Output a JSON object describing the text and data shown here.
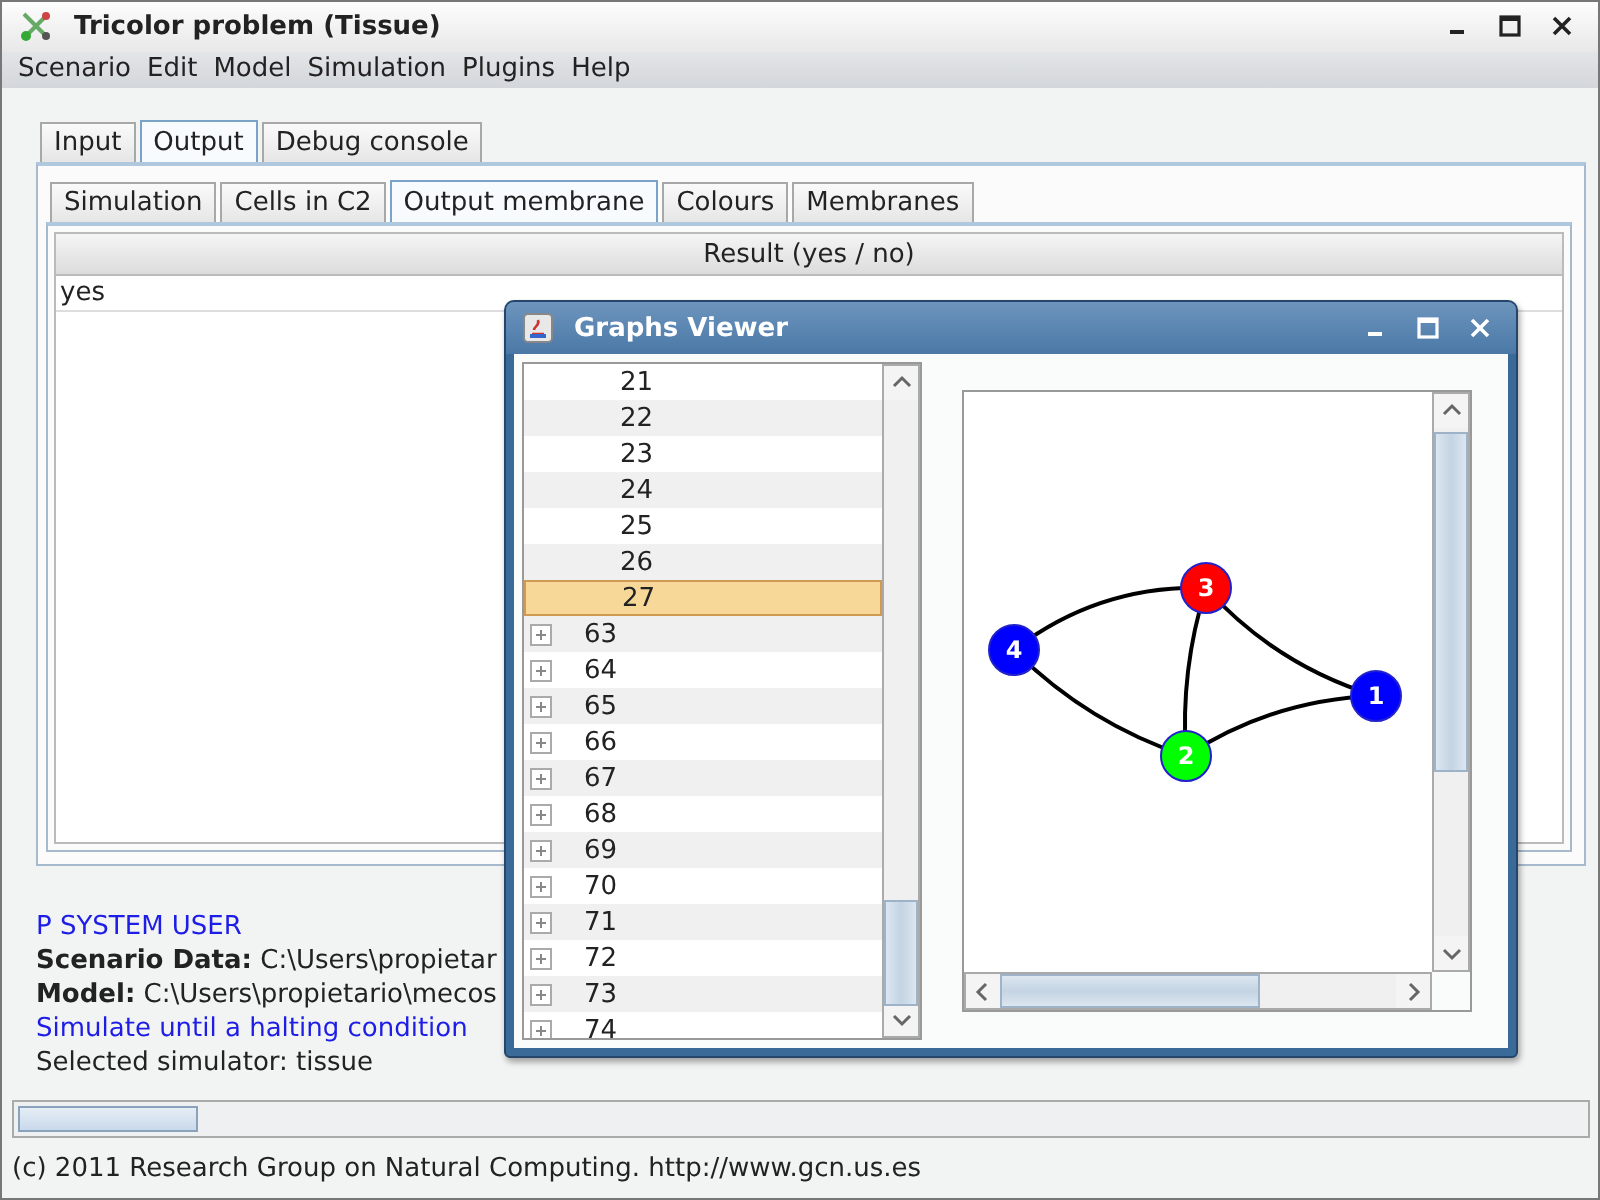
{
  "window": {
    "title": "Tricolor problem (Tissue)"
  },
  "menu": [
    "Scenario",
    "Edit",
    "Model",
    "Simulation",
    "Plugins",
    "Help"
  ],
  "tabs": [
    {
      "label": "Input",
      "selected": false
    },
    {
      "label": "Output",
      "selected": true
    },
    {
      "label": "Debug console",
      "selected": false
    }
  ],
  "subtabs": [
    {
      "label": "Simulation",
      "selected": false
    },
    {
      "label": "Cells in C2",
      "selected": false
    },
    {
      "label": "Output membrane",
      "selected": true
    },
    {
      "label": "Colours",
      "selected": false
    },
    {
      "label": "Membranes",
      "selected": false
    }
  ],
  "table": {
    "columns": [
      "Result (yes / no)"
    ],
    "rows": [
      [
        "yes"
      ]
    ]
  },
  "log": [
    {
      "kind": "info",
      "text": "P SYSTEM USER"
    },
    {
      "kind": "plain",
      "text": "**Scenario Data:** C:\\Users\\propietar"
    },
    {
      "kind": "plain",
      "text": "**Model:** C:\\Users\\propietario\\mecos"
    },
    {
      "kind": "info",
      "text": "Simulate until a halting condition"
    },
    {
      "kind": "plain",
      "text": "Selected simulator: tissue"
    }
  ],
  "progress": {
    "level": 0.12
  },
  "status_bar": "(c) 2011 Research Group on Natural Computing. http://www.gcn.us.es",
  "graphs_viewer": {
    "title": "Graphs Viewer",
    "tree": [
      {
        "label": "21",
        "kind": "child",
        "selected": false
      },
      {
        "label": "22",
        "kind": "child",
        "selected": false
      },
      {
        "label": "23",
        "kind": "child",
        "selected": false
      },
      {
        "label": "24",
        "kind": "child",
        "selected": false
      },
      {
        "label": "25",
        "kind": "child",
        "selected": false
      },
      {
        "label": "26",
        "kind": "child",
        "selected": false
      },
      {
        "label": "27",
        "kind": "child",
        "selected": true
      },
      {
        "label": "63",
        "kind": "node",
        "expanded": false,
        "selected": false
      },
      {
        "label": "64",
        "kind": "node",
        "expanded": false,
        "selected": false
      },
      {
        "label": "65",
        "kind": "node",
        "expanded": false,
        "selected": false
      },
      {
        "label": "66",
        "kind": "node",
        "expanded": false,
        "selected": false
      },
      {
        "label": "67",
        "kind": "node",
        "expanded": false,
        "selected": false
      },
      {
        "label": "68",
        "kind": "node",
        "expanded": false,
        "selected": false
      },
      {
        "label": "69",
        "kind": "node",
        "expanded": false,
        "selected": false
      },
      {
        "label": "70",
        "kind": "node",
        "expanded": false,
        "selected": false
      },
      {
        "label": "71",
        "kind": "node",
        "expanded": false,
        "selected": false
      },
      {
        "label": "72",
        "kind": "node",
        "expanded": false,
        "selected": false
      },
      {
        "label": "73",
        "kind": "node",
        "expanded": false,
        "selected": false
      },
      {
        "label": "74",
        "kind": "node",
        "expanded": false,
        "selected": false
      }
    ],
    "graph": {
      "nodes": [
        {
          "label": "1",
          "color": "#0000ff"
        },
        {
          "label": "2",
          "color": "#00ff00"
        },
        {
          "label": "3",
          "color": "#ff0000"
        },
        {
          "label": "4",
          "color": "#0000ff"
        }
      ]
    }
  }
}
